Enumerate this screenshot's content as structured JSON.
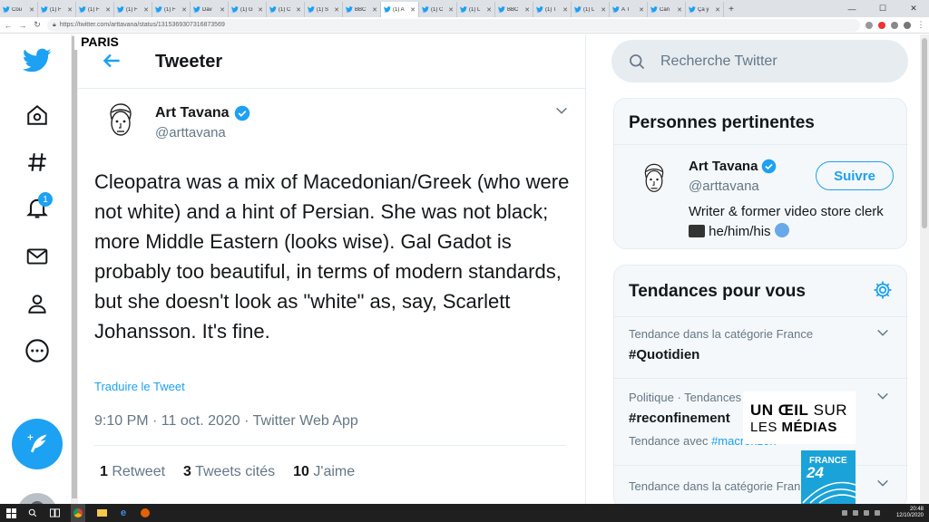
{
  "browser": {
    "tabs": [
      {
        "label": "Cou",
        "active": false
      },
      {
        "label": "(1) F",
        "active": false
      },
      {
        "label": "(1) F",
        "active": false
      },
      {
        "label": "(1) F",
        "active": false
      },
      {
        "label": "(1) F",
        "active": false
      },
      {
        "label": "Dav",
        "active": false
      },
      {
        "label": "(1) G",
        "active": false
      },
      {
        "label": "(1) C",
        "active": false
      },
      {
        "label": "(1) S",
        "active": false
      },
      {
        "label": "BBC",
        "active": false
      },
      {
        "label": "(1) A",
        "active": true
      },
      {
        "label": "(1) C",
        "active": false
      },
      {
        "label": "(1) L",
        "active": false
      },
      {
        "label": "BBC",
        "active": false
      },
      {
        "label": "(1) T",
        "active": false
      },
      {
        "label": "(1) L",
        "active": false
      },
      {
        "label": "À T",
        "active": false
      },
      {
        "label": "Can",
        "active": false
      },
      {
        "label": "Ça y",
        "active": false
      }
    ],
    "new_tab": "+",
    "url": "https://twitter.com/arttavana/status/1315369307316873569"
  },
  "overlay": {
    "location": "PARIS",
    "show_line1_bold": "UN ŒIL",
    "show_line1_light": " SUR",
    "show_line2_light": "LES ",
    "show_line2_bold": "MÉDIAS",
    "channel_top": "FRANCE",
    "channel_bottom": "24"
  },
  "header": {
    "title": "Tweeter"
  },
  "tweet": {
    "author_name": "Art Tavana",
    "author_handle": "@arttavana",
    "text": "Cleopatra was a mix of Macedonian/Greek (who were not white) and a hint of Persian. She was not black; more Middle Eastern (looks wise). Gal Gadot is probably too beautiful, in terms of modern standards, but she doesn't look as \"white\" as, say, Scarlett Johansson. It's fine.",
    "translate": "Traduire le Tweet",
    "meta": "9:10 PM · 11 oct. 2020 · Twitter Web App",
    "retweets_count": "1",
    "retweets_label": " Retweet",
    "quotes_count": "3",
    "quotes_label": " Tweets cités",
    "likes_count": "10",
    "likes_label": " J'aime"
  },
  "search": {
    "placeholder": "Recherche Twitter"
  },
  "relevant": {
    "title": "Personnes pertinentes",
    "name": "Art Tavana",
    "handle": "@arttavana",
    "follow": "Suivre",
    "bio_part1": "Writer & former video store clerk ",
    "bio_part2": " he/him/his "
  },
  "trends": {
    "title": "Tendances pour vous",
    "items": [
      {
        "category": "Tendance dans la catégorie France",
        "tag": "#Quotidien",
        "sub_prefix": "",
        "sub_link": ""
      },
      {
        "category": "Politique · Tendances",
        "tag": "#reconfinement",
        "sub_prefix": "Tendance avec ",
        "sub_link": "#macronzon"
      },
      {
        "category": "Tendance dans la catégorie Fran",
        "tag": "",
        "sub_prefix": "",
        "sub_link": ""
      }
    ]
  },
  "taskbar": {
    "time": "20:48",
    "date": "12/10/2020"
  },
  "colors": {
    "accent": "#1da1f2",
    "text": "#14171a",
    "muted": "#657786"
  }
}
